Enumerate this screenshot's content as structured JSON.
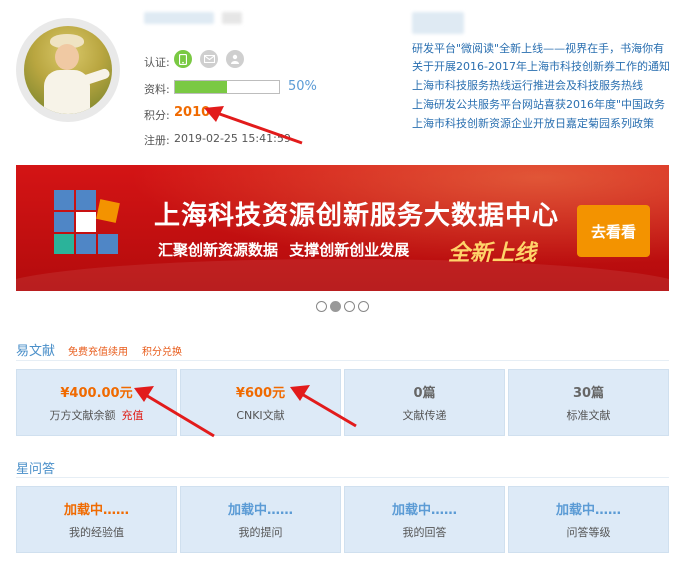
{
  "profile": {
    "verify_label": "认证:",
    "info_label": "资料:",
    "info_percent": "50%",
    "info_progress": 0.5,
    "score_label": "积分:",
    "score_value": "2010",
    "register_label": "注册:",
    "register_time": "2019-02-25 15:41:59",
    "verify_icons": [
      "phone-icon",
      "mail-icon",
      "user-icon"
    ]
  },
  "news": {
    "items": [
      "研发平台\"微阅读\"全新上线——视界在手，书海你有",
      "关于开展2016-2017年上海市科技创新券工作的通知",
      "上海市科技服务热线运行推进会及科技服务热线",
      "上海研发公共服务平台网站喜获2016年度\"中国政务",
      "上海市科技创新资源企业开放日嘉定菊园系列政策"
    ]
  },
  "banner": {
    "title": "上海科技资源创新服务大数据中心",
    "subtitle": "汇聚创新资源数据 支撑创新创业发展",
    "script": "全新上线",
    "button": "去看看"
  },
  "carousel": {
    "count": 4,
    "active": 1
  },
  "ewenxian": {
    "title": "易文献",
    "link1": "免费充值续用",
    "link2": "积分兑换",
    "cards": [
      {
        "value": "¥400.00元",
        "caption": "万方文献余额",
        "action": "充值"
      },
      {
        "value": "¥600元",
        "caption": "CNKI文献"
      },
      {
        "value": "0篇",
        "caption": "文献传递"
      },
      {
        "value": "30篇",
        "caption": "标准文献"
      }
    ]
  },
  "xingwenda": {
    "title": "星问答",
    "cards": [
      {
        "value": "加载中……",
        "caption": "我的经验值"
      },
      {
        "value": "加载中……",
        "caption": "我的提问"
      },
      {
        "value": "加载中……",
        "caption": "我的回答"
      },
      {
        "value": "加载中……",
        "caption": "问答等级"
      }
    ]
  },
  "colors": {
    "accent_orange": "#f06a00",
    "link_blue": "#2a6fb0",
    "card_bg": "#ddeaf7",
    "banner_red": "#c8100f",
    "arrow_red": "#e21b1b"
  }
}
